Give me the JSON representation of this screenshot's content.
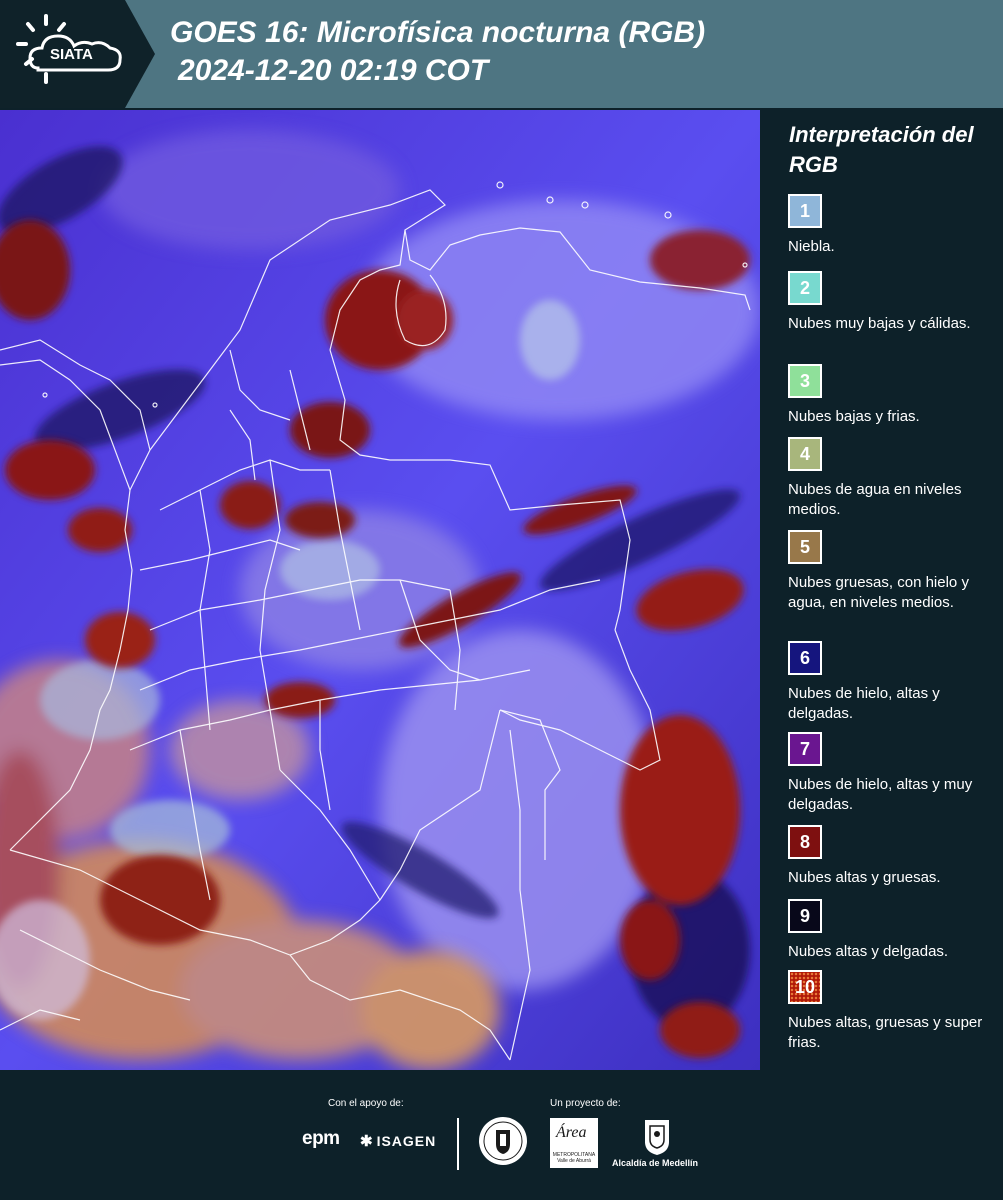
{
  "header": {
    "logo_text": "SIATA",
    "title_line1": "GOES 16: Microfísica nocturna (RGB)",
    "title_line2": "2024-12-20 02:19 COT"
  },
  "map": {
    "image_type": "satellite-rgb-composite",
    "region": "Colombia",
    "boundary_color": "#ffffff"
  },
  "legend": {
    "title": "Interpretación del RGB",
    "items": [
      {
        "number": "1",
        "label": "Niebla.",
        "color": "#8fb6d9"
      },
      {
        "number": "2",
        "label": "Nubes muy bajas y cálidas.",
        "color": "#78d9cf"
      },
      {
        "number": "3",
        "label": "Nubes bajas y frias.",
        "color": "#8fe09a"
      },
      {
        "number": "4",
        "label": "Nubes de agua en niveles medios.",
        "color": "#a8b67c"
      },
      {
        "number": "5",
        "label": "Nubes gruesas, con hielo y agua, en niveles medios.",
        "color": "#98784a"
      },
      {
        "number": "6",
        "label": "Nubes de hielo, altas y delgadas.",
        "color": "#15157e"
      },
      {
        "number": "7",
        "label": "Nubes de hielo, altas y muy delgadas.",
        "color": "#6a1690"
      },
      {
        "number": "8",
        "label": "Nubes altas y gruesas.",
        "color": "#7e1010"
      },
      {
        "number": "9",
        "label": "Nubes altas y delgadas.",
        "color": "#08081a"
      },
      {
        "number": "10",
        "label": "Nubes altas, gruesas y super frias.",
        "color": "#b01808"
      }
    ]
  },
  "footer": {
    "support_caption": "Con el apoyo de:",
    "project_caption": "Un proyecto de:",
    "epm_logo": "epm",
    "isagen_logo": "ISAGEN",
    "area_logo": "Área",
    "area_subtitle": "METROPOLITANA Valle de Aburrá",
    "medellin_label": "Alcaldía de Medellín"
  }
}
